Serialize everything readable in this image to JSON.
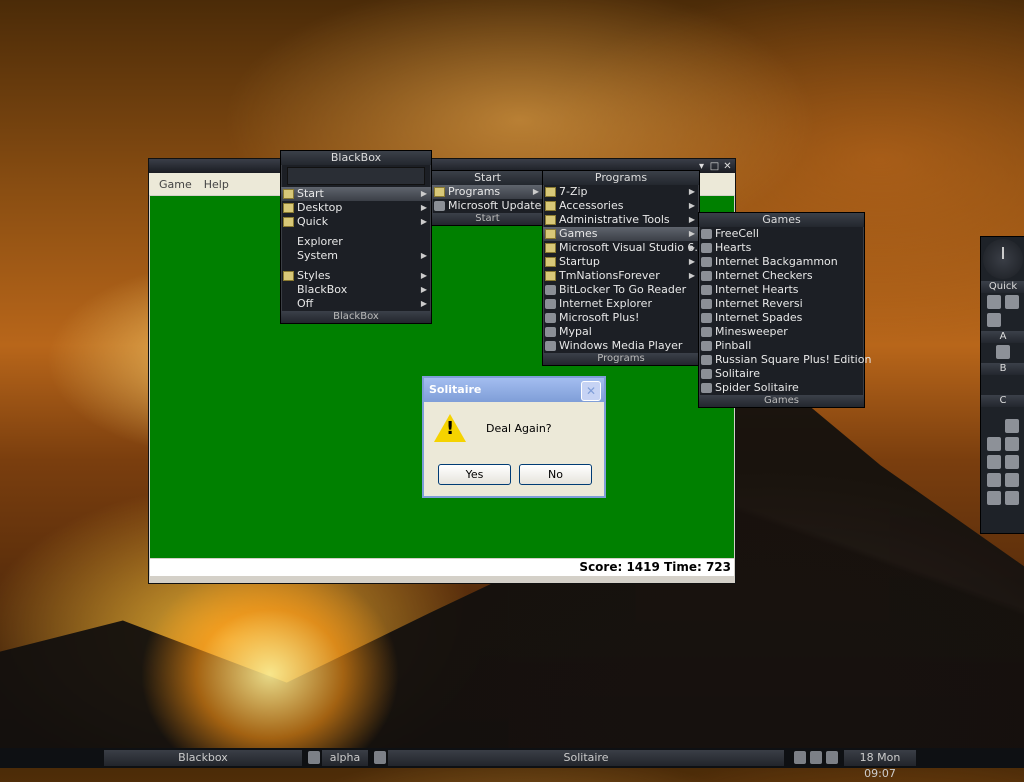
{
  "solitaire": {
    "menu": [
      "Game",
      "Help"
    ],
    "status": "Score: 1419 Time: 723"
  },
  "dialog": {
    "title": "Solitaire",
    "message": "Deal Again?",
    "yes": "Yes",
    "no": "No"
  },
  "blackbox_menu": {
    "title": "BlackBox",
    "footer": "BlackBox",
    "items": [
      "Start",
      "Desktop",
      "Quick",
      "Explorer",
      "System",
      "Styles",
      "BlackBox",
      "Off"
    ]
  },
  "start_menu": {
    "title": "Start",
    "footer": "Start",
    "items": [
      "Programs",
      "Microsoft Update"
    ]
  },
  "programs_menu": {
    "title": "Programs",
    "footer": "Programs",
    "items": [
      "7-Zip",
      "Accessories",
      "Administrative Tools",
      "Games",
      "Microsoft Visual Studio 6.0",
      "Startup",
      "TmNationsForever",
      "BitLocker To Go Reader",
      "Internet Explorer",
      "Microsoft Plus!",
      "Mypal",
      "Windows Media Player"
    ]
  },
  "games_menu": {
    "title": "Games",
    "footer": "Games",
    "items": [
      "FreeCell",
      "Hearts",
      "Internet Backgammon",
      "Internet Checkers",
      "Internet Hearts",
      "Internet Reversi",
      "Internet Spades",
      "Minesweeper",
      "Pinball",
      "Russian Square Plus! Edition",
      "Solitaire",
      "Spider Solitaire"
    ]
  },
  "dock": {
    "labels": [
      "Quick",
      "A",
      "B",
      "C"
    ]
  },
  "taskbar": {
    "workspace": "Blackbox",
    "tab_alpha": "alpha",
    "active_window": "Solitaire",
    "clock": "18 Mon 09:07"
  }
}
